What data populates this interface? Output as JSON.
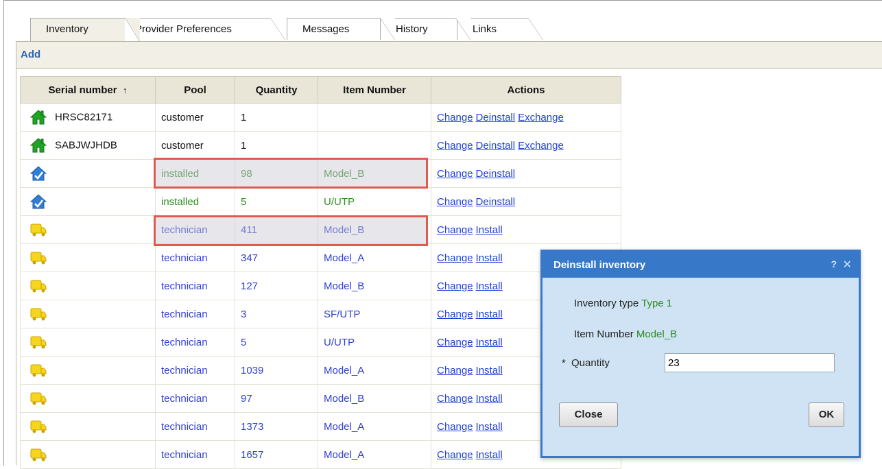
{
  "tabs": [
    {
      "label": "Inventory",
      "active": true
    },
    {
      "label": "Provider Preferences",
      "active": false
    },
    {
      "label": "Messages",
      "active": false
    },
    {
      "label": "History",
      "active": false
    },
    {
      "label": "Links",
      "active": false
    }
  ],
  "toolbar": {
    "add_label": "Add"
  },
  "table": {
    "headers": {
      "serial": "Serial number",
      "sort_arrow": "↑",
      "pool": "Pool",
      "quantity": "Quantity",
      "item": "Item Number",
      "actions": "Actions"
    },
    "rows": [
      {
        "icon": "green-house-icon",
        "serial": "HRSC82171",
        "pool": "customer",
        "quantity": "1",
        "item": "",
        "color": "black",
        "actions": [
          "Change",
          "Deinstall",
          "Exchange"
        ]
      },
      {
        "icon": "green-house-icon",
        "serial": "SABJWJHDB",
        "pool": "customer",
        "quantity": "1",
        "item": "",
        "color": "black",
        "actions": [
          "Change",
          "Deinstall",
          "Exchange"
        ]
      },
      {
        "icon": "blue-house-check-icon",
        "serial": "",
        "pool": "installed",
        "quantity": "98",
        "item": "Model_B",
        "color": "green",
        "actions": [
          "Change",
          "Deinstall"
        ]
      },
      {
        "icon": "blue-house-check-icon",
        "serial": "",
        "pool": "installed",
        "quantity": "5",
        "item": "U/UTP",
        "color": "green",
        "actions": [
          "Change",
          "Deinstall"
        ]
      },
      {
        "icon": "yellow-truck-icon",
        "serial": "",
        "pool": "technician",
        "quantity": "411",
        "item": "Model_B",
        "color": "blue",
        "actions": [
          "Change",
          "Install"
        ]
      },
      {
        "icon": "yellow-truck-icon",
        "serial": "",
        "pool": "technician",
        "quantity": "347",
        "item": "Model_A",
        "color": "blue",
        "actions": [
          "Change",
          "Install"
        ]
      },
      {
        "icon": "yellow-truck-icon",
        "serial": "",
        "pool": "technician",
        "quantity": "127",
        "item": "Model_B",
        "color": "blue",
        "actions": [
          "Change",
          "Install"
        ]
      },
      {
        "icon": "yellow-truck-icon",
        "serial": "",
        "pool": "technician",
        "quantity": "3",
        "item": "SF/UTP",
        "color": "blue",
        "actions": [
          "Change",
          "Install"
        ]
      },
      {
        "icon": "yellow-truck-icon",
        "serial": "",
        "pool": "technician",
        "quantity": "5",
        "item": "U/UTP",
        "color": "blue",
        "actions": [
          "Change",
          "Install"
        ]
      },
      {
        "icon": "yellow-truck-icon",
        "serial": "",
        "pool": "technician",
        "quantity": "1039",
        "item": "Model_A",
        "color": "blue",
        "actions": [
          "Change",
          "Install"
        ]
      },
      {
        "icon": "yellow-truck-icon",
        "serial": "",
        "pool": "technician",
        "quantity": "97",
        "item": "Model_B",
        "color": "blue",
        "actions": [
          "Change",
          "Install"
        ]
      },
      {
        "icon": "yellow-truck-icon",
        "serial": "",
        "pool": "technician",
        "quantity": "1373",
        "item": "Model_A",
        "color": "blue",
        "actions": [
          "Change",
          "Install"
        ]
      },
      {
        "icon": "yellow-truck-icon",
        "serial": "",
        "pool": "technician",
        "quantity": "1657",
        "item": "Model_A",
        "color": "blue",
        "actions": [
          "Change",
          "Install"
        ]
      }
    ]
  },
  "dialog": {
    "title": "Deinstall inventory",
    "help": "?",
    "close_glyph": "✕",
    "inventory_type_label": "Inventory type",
    "inventory_type_value": "Type 1",
    "item_number_label": "Item Number",
    "item_number_value": "Model_B",
    "quantity_required_mark": "*",
    "quantity_label": "Quantity",
    "quantity_value": "23",
    "close_button": "Close",
    "ok_button": "OK"
  },
  "colors": {
    "green_text": "#2e8b20",
    "blue_text": "#2f3fd0",
    "link": "#2241d4",
    "highlight_border": "#e05a4e",
    "dialog_header": "#3778c9",
    "dialog_body": "#cfe3f5"
  }
}
